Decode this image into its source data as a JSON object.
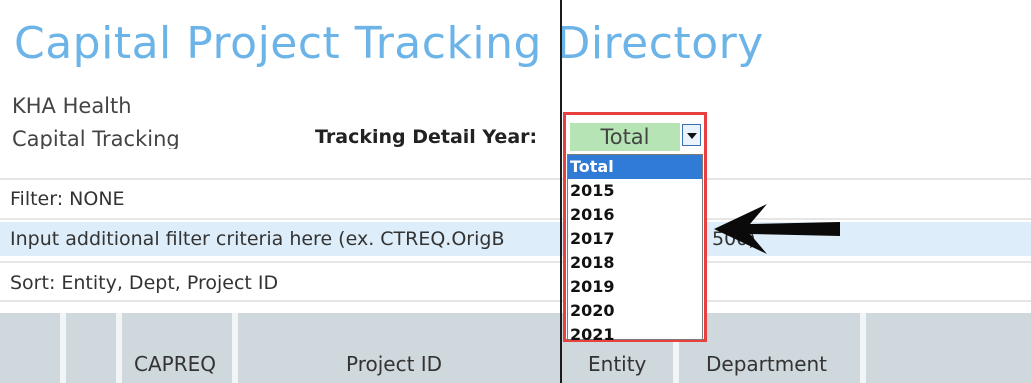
{
  "title": "Capital Project Tracking Directory",
  "subtitle_line1": "KHA Health",
  "subtitle_line2": "Capital Tracking",
  "tracking_detail": {
    "label": "Tracking Detail Year:",
    "selected_value": "Total",
    "options": [
      "Total",
      "2015",
      "2016",
      "2017",
      "2018",
      "2019",
      "2020",
      "2021"
    ]
  },
  "filter_text": "Filter: NONE",
  "input_row_text": "Input additional filter criteria here (ex. CTREQ.OrigB",
  "input_row_suffix": "500)",
  "sort_text": "Sort: Entity, Dept, Project ID",
  "columns": [
    "CAPREQ",
    "Project ID",
    "Entity",
    "Department"
  ],
  "colors": {
    "title": "#6cb4e8",
    "combo_border": "#e8403f",
    "combo_value_bg": "#b7e4b4",
    "selected_option": "#2f7bd6",
    "input_row_bg": "#ddeefa",
    "header_bg": "#cfd8dd"
  },
  "icons": {
    "dropdown_button": "chevron-down-icon",
    "pointer_arrow": "arrow-left-icon"
  }
}
